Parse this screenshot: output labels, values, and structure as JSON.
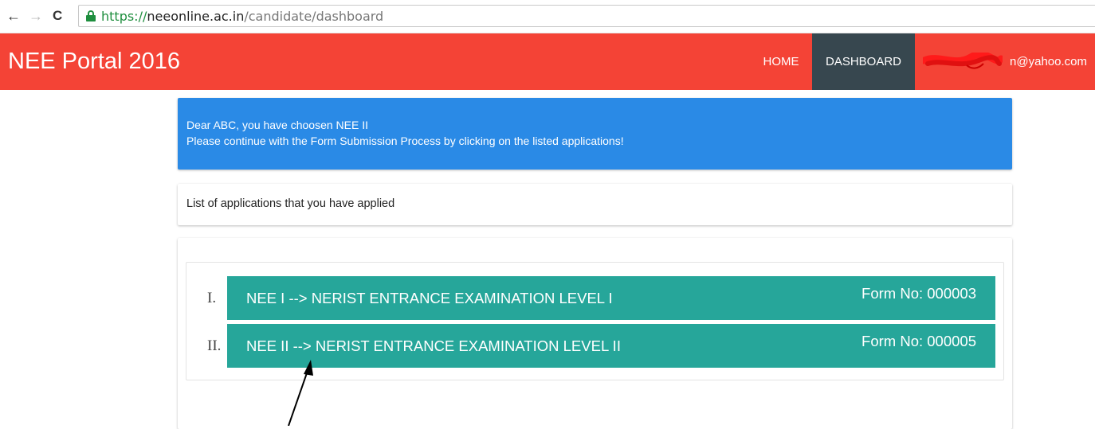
{
  "browser": {
    "url_scheme": "https://",
    "url_host": "neeonline.ac.in",
    "url_path": "/candidate/dashboard"
  },
  "header": {
    "brand": "NEE Portal 2016",
    "nav": {
      "home": "HOME",
      "dashboard": "DASHBOARD",
      "user_email_visible": "n@yahoo.com"
    },
    "colors": {
      "bar": "#f44336",
      "active_tab": "#37474f"
    }
  },
  "notice": {
    "line1": "Dear ABC, you have choosen NEE II",
    "line2": "Please continue with the Form Submission Process by clicking on the listed applications!",
    "color": "#2a8ae6"
  },
  "list_title": "List of applications that you have applied",
  "applications": [
    {
      "numeral": "I.",
      "name": "NEE I --> NERIST ENTRANCE EXAMINATION LEVEL I",
      "form_no": "Form No: 000003"
    },
    {
      "numeral": "II.",
      "name": "NEE II --> NERIST ENTRANCE EXAMINATION LEVEL II",
      "form_no": "Form No: 000005"
    }
  ],
  "tile_color": "#26a69a"
}
